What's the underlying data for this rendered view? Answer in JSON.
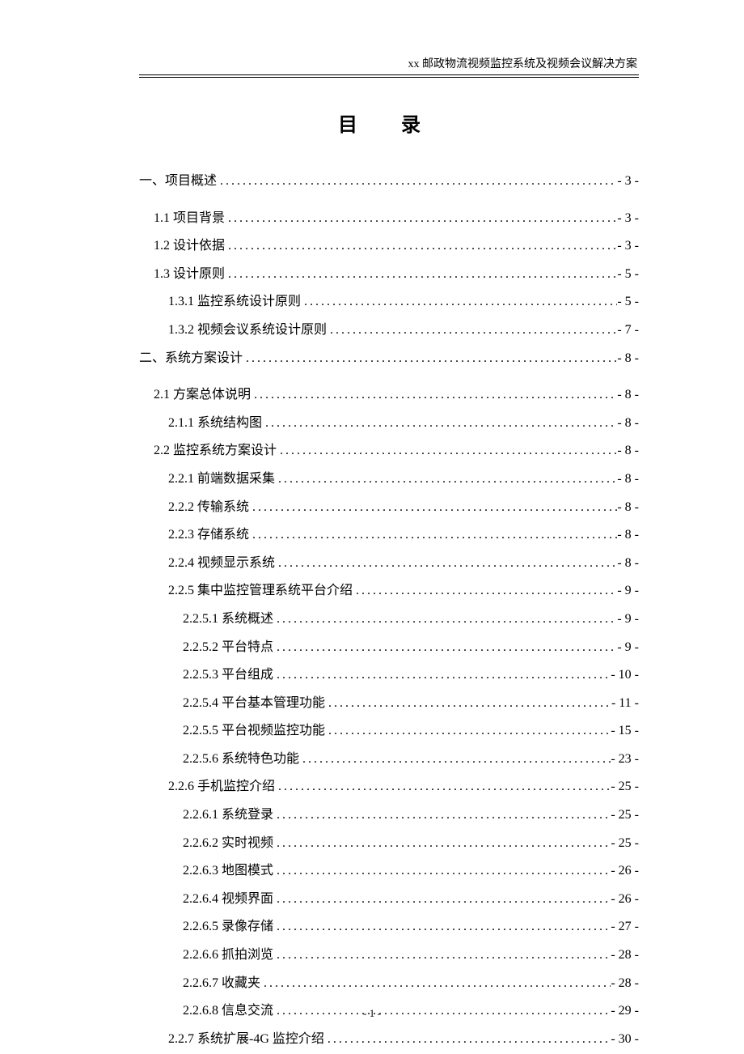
{
  "header": "xx 邮政物流视频监控系统及视频会议解决方案",
  "toc_title": "目 录",
  "page_number": "- 1 -",
  "entries": [
    {
      "label": "一、项目概述",
      "page": "- 3 -",
      "indent": 0,
      "section": true
    },
    {
      "label": "1.1 项目背景 ",
      "page": "- 3 -",
      "indent": 1
    },
    {
      "label": "1.2 设计依据 ",
      "page": "- 3 -",
      "indent": 1
    },
    {
      "label": "1.3 设计原则 ",
      "page": "- 5 -",
      "indent": 1
    },
    {
      "label": "1.3.1 监控系统设计原则",
      "page": "- 5 -",
      "indent": 2
    },
    {
      "label": "1.3.2 视频会议系统设计原则",
      "page": "- 7 -",
      "indent": 2
    },
    {
      "label": "二、系统方案设计",
      "page": "- 8 -",
      "indent": 0,
      "section": true
    },
    {
      "label": "2.1 方案总体说明 ",
      "page": "- 8 -",
      "indent": 1
    },
    {
      "label": "2.1.1 系统结构图",
      "page": "- 8 -",
      "indent": 2
    },
    {
      "label": "2.2 监控系统方案设计 ",
      "page": "- 8 -",
      "indent": 1
    },
    {
      "label": "2.2.1 前端数据采集",
      "page": "- 8 -",
      "indent": 2
    },
    {
      "label": "2.2.2 传输系统",
      "page": "- 8 -",
      "indent": 2
    },
    {
      "label": "2.2.3 存储系统",
      "page": "- 8 -",
      "indent": 2
    },
    {
      "label": "2.2.4 视频显示系统",
      "page": "- 8 -",
      "indent": 2
    },
    {
      "label": "2.2.5 集中监控管理系统平台介绍",
      "page": "- 9 -",
      "indent": 2
    },
    {
      "label": "2.2.5.1 系统概述",
      "page": "- 9 -",
      "indent": 3
    },
    {
      "label": "2.2.5.2 平台特点",
      "page": "- 9 -",
      "indent": 3
    },
    {
      "label": "2.2.5.3 平台组成",
      "page": "- 10 -",
      "indent": 3
    },
    {
      "label": "2.2.5.4 平台基本管理功能",
      "page": "- 11 -",
      "indent": 3
    },
    {
      "label": "2.2.5.5 平台视频监控功能",
      "page": "- 15 -",
      "indent": 3
    },
    {
      "label": "2.2.5.6 系统特色功能",
      "page": "- 23 -",
      "indent": 3
    },
    {
      "label": "2.2.6 手机监控介绍",
      "page": "- 25 -",
      "indent": 2
    },
    {
      "label": "2.2.6.1 系统登录",
      "page": "- 25 -",
      "indent": 3
    },
    {
      "label": "2.2.6.2 实时视频",
      "page": "- 25 -",
      "indent": 3
    },
    {
      "label": "2.2.6.3 地图模式",
      "page": "- 26 -",
      "indent": 3
    },
    {
      "label": "2.2.6.4 视频界面",
      "page": "- 26 -",
      "indent": 3
    },
    {
      "label": "2.2.6.5 录像存储",
      "page": "- 27 -",
      "indent": 3
    },
    {
      "label": "2.2.6.6 抓拍浏览",
      "page": "- 28 -",
      "indent": 3
    },
    {
      "label": "2.2.6.7 收藏夹",
      "page": "- 28 -",
      "indent": 3
    },
    {
      "label": "2.2.6.8 信息交流",
      "page": "- 29 -",
      "indent": 3
    },
    {
      "label": "2.2.7 系统扩展-4G 监控介绍 ",
      "page": "- 30 -",
      "indent": 2
    }
  ]
}
